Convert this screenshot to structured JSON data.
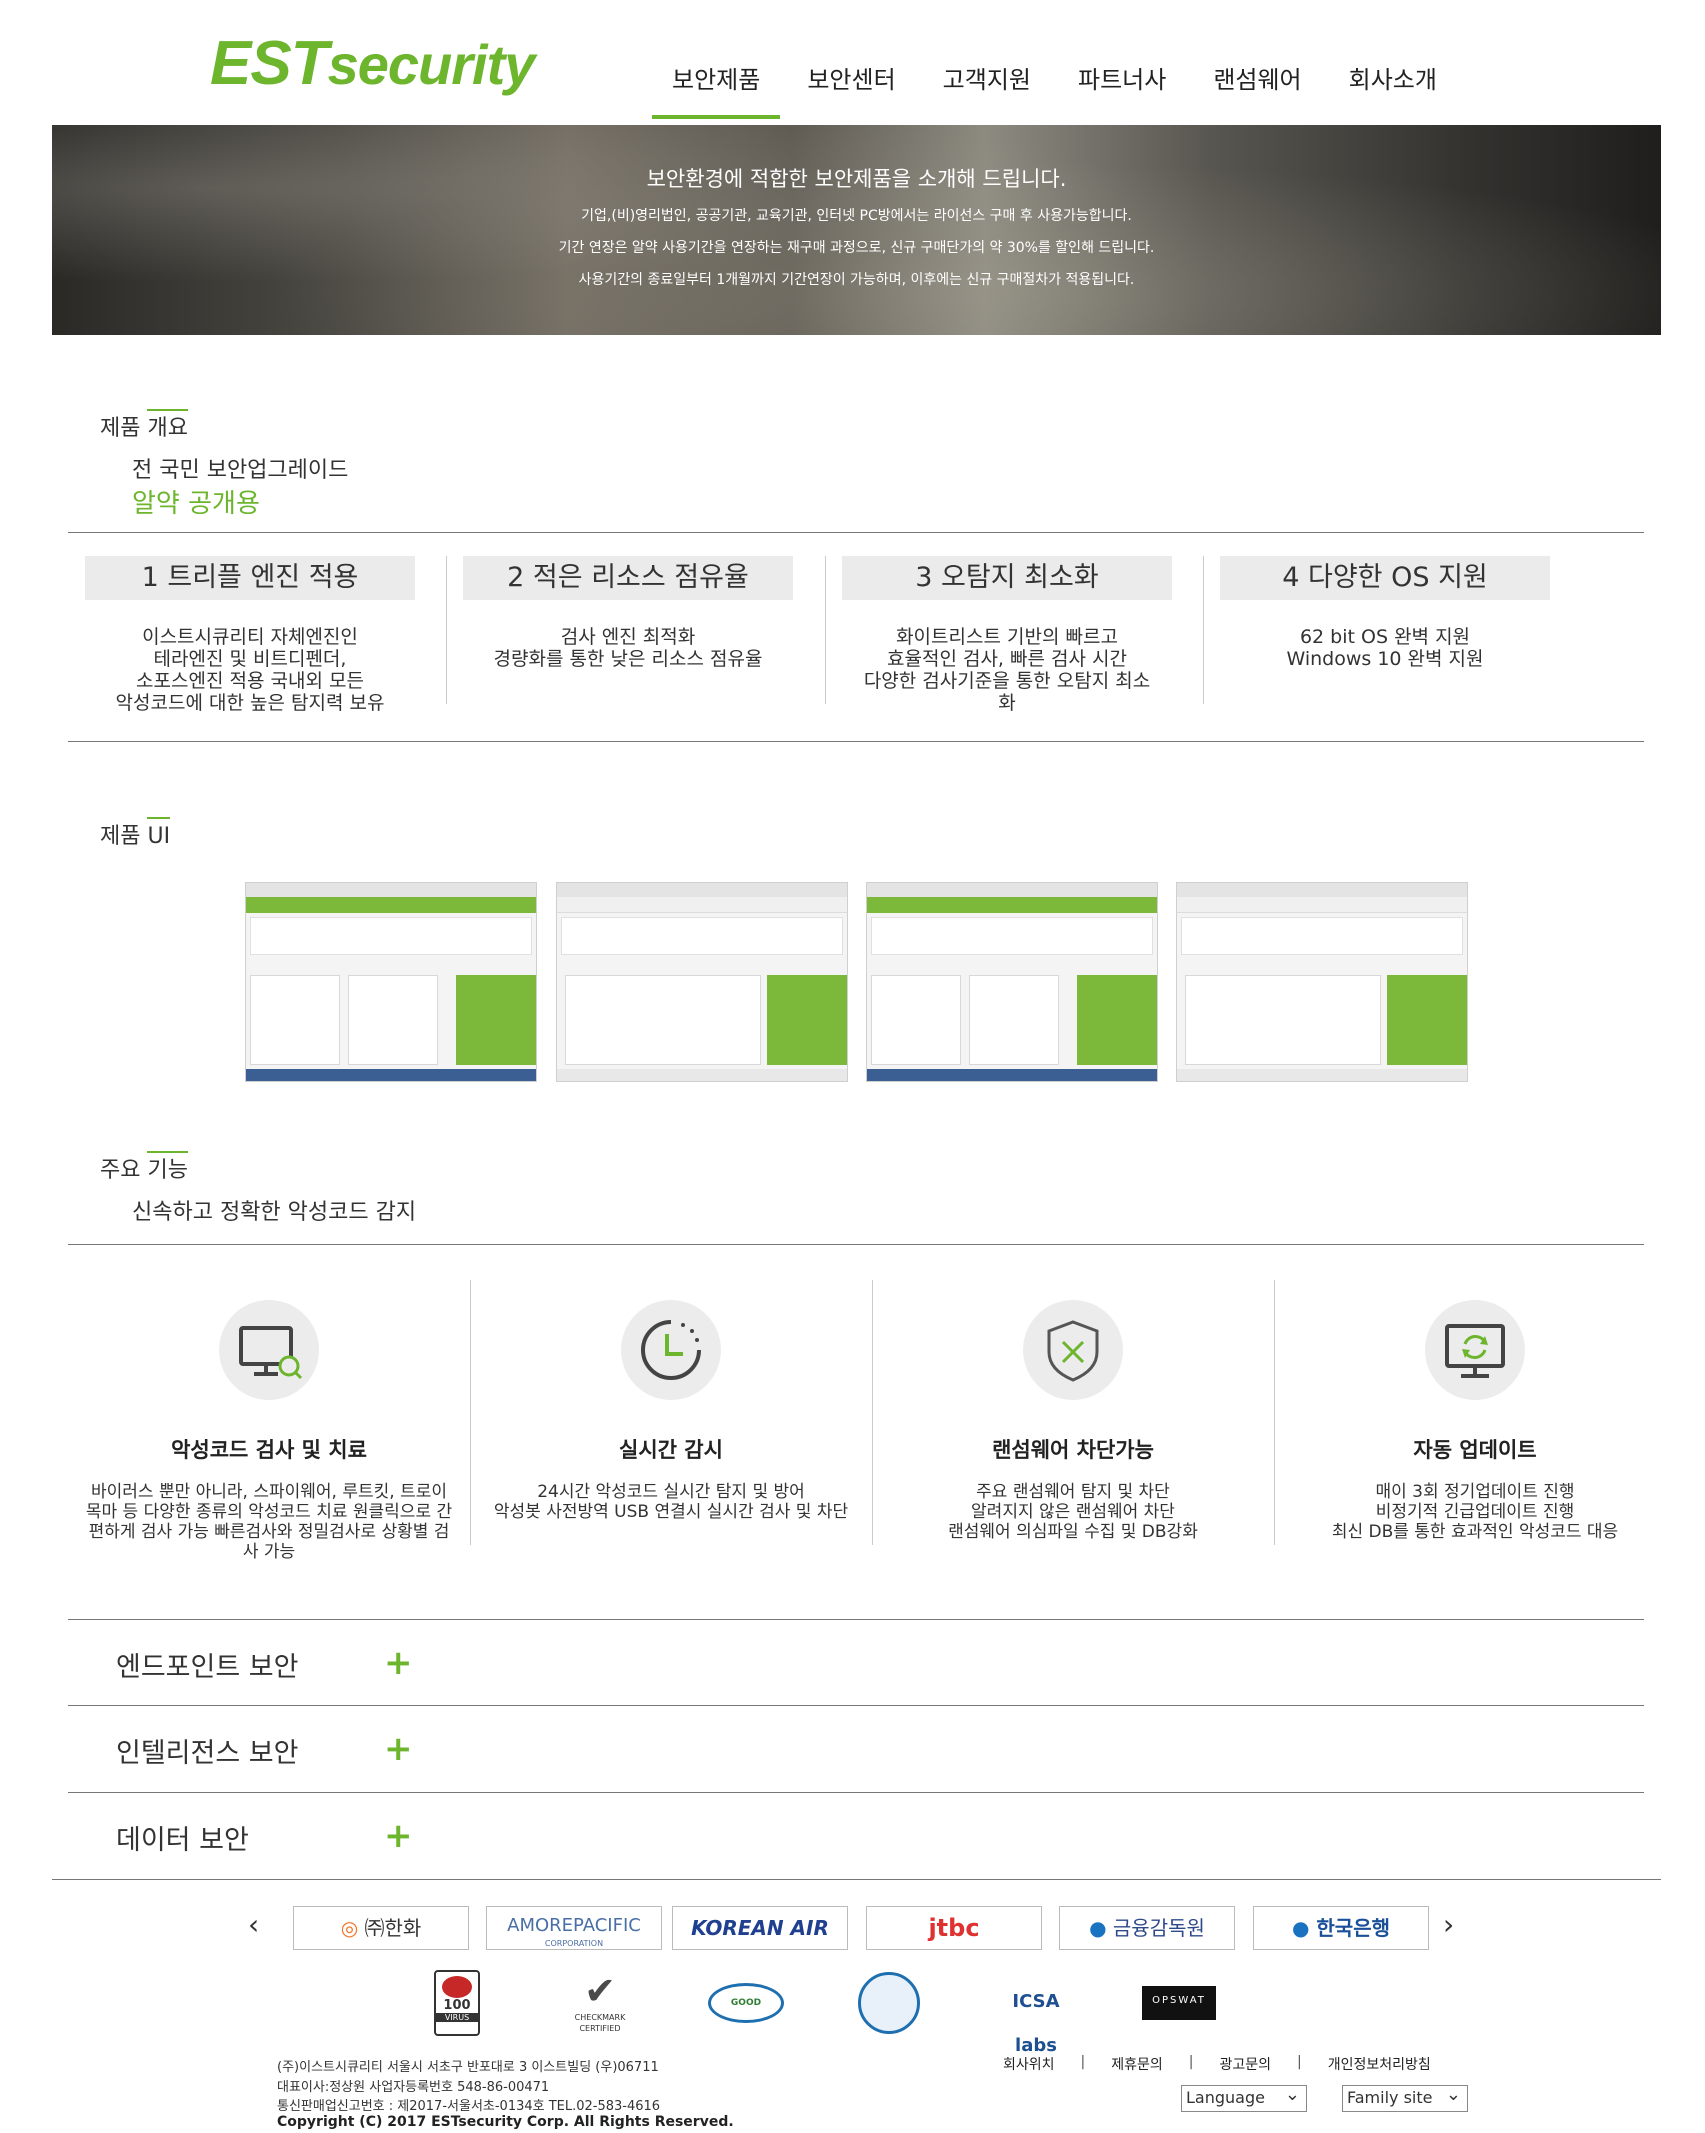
{
  "brand": {
    "logo_main": "EST",
    "logo_sub": "security",
    "color": "#6cb52d"
  },
  "nav": [
    "보안제품",
    "보안센터",
    "고객지원",
    "파트너사",
    "랜섬웨어",
    "회사소개"
  ],
  "banner": {
    "title": "보안환경에 적합한 보안제품을 소개해 드립니다.",
    "lines": [
      "기업,(비)영리법인, 공공기관, 교육기관, 인터넷 PC방에서는 라이선스 구매 후 사용가능합니다.",
      "기간 연장은 알약 사용기간을 연장하는 재구매 과정으로, 신규 구매단가의 약 30%를 할인해 드립니다.",
      "사용기간의 종료일부터 1개월까지 기간연장이 가능하며, 이후에는 신규 구매절차가 적용됩니다."
    ]
  },
  "overview": {
    "title_a": "제품 ",
    "title_b": "개요",
    "sub": "전 국민 보안업그레이드",
    "product": "알약 공개용",
    "features": [
      {
        "title": "1 트리플 엔진 적용",
        "desc": [
          "이스트시큐리티 자체엔진인",
          "테라엔진 및 비트디펜더,",
          "소포스엔진 적용 국내외 모든",
          "악성코드에 대한 높은 탐지력 보유"
        ]
      },
      {
        "title": "2 적은 리소스 점유율",
        "desc": [
          "검사 엔진 최적화",
          "경량화를 통한 낮은 리소스 점유율"
        ]
      },
      {
        "title": "3 오탐지 최소화",
        "desc": [
          "화이트리스트 기반의 빠르고",
          "효율적인 검사, 빠른 검사 시간",
          "다양한 검사기준을 통한 오탐지 최소",
          "화"
        ]
      },
      {
        "title": "4 다양한 OS 지원",
        "desc": [
          "62 bit OS 완벽 지원",
          "Windows 10 완벽 지원"
        ]
      }
    ]
  },
  "ui": {
    "title_a": "제품 ",
    "title_b": "UI"
  },
  "functions": {
    "title_a": "주요 ",
    "title_b": "기능",
    "sub": "신속하고 정확한 악성코드 감지",
    "items": [
      {
        "icon": "monitor-search-icon",
        "title": "악성코드 검사 및 치료",
        "desc": [
          "바이러스 뿐만 아니라, 스파이웨어, 루트킷, 트로이",
          "목마 등 다양한 종류의 악성코드 치료 원클릭으로 간",
          "편하게 검사 가능 빠른검사와 정밀검사로 상황별 검",
          "사 가능"
        ]
      },
      {
        "icon": "clock-icon",
        "title": "실시간 감시",
        "desc": [
          "24시간 악성코드 실시간 탐지 및 방어",
          "악성봇 사전방역 USB 연결시 실시간 검사 및 차단"
        ]
      },
      {
        "icon": "shield-icon",
        "title": "랜섬웨어 차단가능",
        "desc": [
          "주요 랜섬웨어 탐지 및 차단",
          "알려지지 않은 랜섬웨어 차단",
          "랜섬웨어 의심파일 수집 및 DB강화"
        ]
      },
      {
        "icon": "monitor-refresh-icon",
        "title": "자동 업데이트",
        "desc": [
          "매이 3회 정기업데이트 진행",
          "비정기적 긴급업데이트 진행",
          "최신 DB를 통한 효과적인 악성코드 대응"
        ]
      }
    ]
  },
  "accordions": [
    "엔드포인트 보안",
    "인텔리전스 보안",
    "데이터 보안"
  ],
  "partners": [
    "㈜한화",
    "AMOREPACIFIC",
    "KOREAN AIR",
    "jtbc",
    "금융감독원",
    "한국은행"
  ],
  "partner_sub": "CORPORATION",
  "certs": [
    {
      "icon": "vb100-icon",
      "label": "VIRUS"
    },
    {
      "icon": "checkmark-icon",
      "label": "CHECKMARK CERTIFIED"
    },
    {
      "icon": "gs-icon",
      "label": "GOOD"
    },
    {
      "icon": "itsec-icon",
      "label": ""
    },
    {
      "icon": "icsa-icon",
      "label": "ICSA labs"
    },
    {
      "icon": "opswat-icon",
      "label": "OPSWAT"
    }
  ],
  "footer": {
    "address": "(주)이스트시큐리티 서울시 서초구 반포대로 3 이스트빌딩 (우)06711",
    "ceo": "대표이사:정상원 사업자등록번호 548-86-00471",
    "license": "통신판매업신고번호 : 제2017-서울서초-0134호 TEL.02-583-4616",
    "copyright": "Copyright (C) 2017 ESTsecurity Corp. All Rights Reserved.",
    "links": [
      "회사위치",
      "제휴문의",
      "광고문의",
      "개인정보처리방침"
    ],
    "language": "Language",
    "family": "Family site"
  }
}
